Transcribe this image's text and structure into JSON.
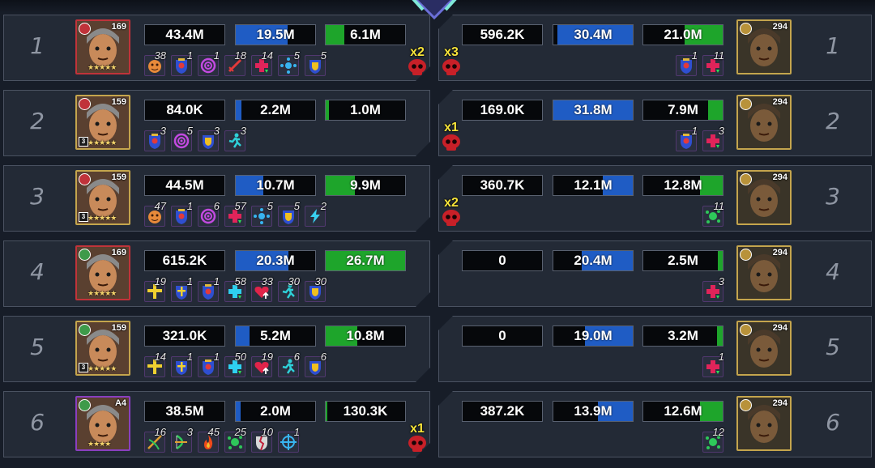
{
  "colors": {
    "damage": "#d8202a",
    "tank": "#1f5cc4",
    "heal": "#1ea52b",
    "gold_frame": "#c4a54d",
    "red_frame": "#c0333a",
    "purple_frame": "#8a3fc0",
    "kill_label": "#f6e43a"
  },
  "rows": [
    {
      "rank": "1",
      "left": {
        "hero": {
          "level": "169",
          "frame": "red",
          "faction": "red",
          "stars": "★★★★★",
          "awaken": ""
        },
        "stats": {
          "damage": {
            "label": "43.4M",
            "fill": 1.0
          },
          "tank": {
            "label": "19.5M",
            "fill": 0.65
          },
          "heal": {
            "label": "6.1M",
            "fill": 0.23
          }
        },
        "buffs": [
          {
            "icon": "orange-face-icon",
            "count": "38"
          },
          {
            "icon": "shield-crest-icon",
            "count": "1"
          },
          {
            "icon": "purple-swirl-icon",
            "count": "1"
          },
          {
            "icon": "red-sword-icon",
            "count": "18"
          },
          {
            "icon": "red-heal-cross-icon",
            "count": "14"
          },
          {
            "icon": "blue-burst-icon",
            "count": "5"
          },
          {
            "icon": "gold-shield-icon",
            "count": "5"
          }
        ],
        "kills": "x2"
      },
      "right": {
        "hero": {
          "level": "294",
          "frame": "gold",
          "faction": "gold"
        },
        "stats": {
          "damage": {
            "label": "596.2K",
            "fill": 0.02
          },
          "tank": {
            "label": "30.4M",
            "fill": 0.95
          },
          "heal": {
            "label": "21.0M",
            "fill": 0.48
          }
        },
        "buffs": [
          {
            "icon": "red-heal-cross-icon",
            "count": "11"
          },
          {
            "icon": "shield-crest-icon",
            "count": "1"
          }
        ],
        "kills": "x3"
      }
    },
    {
      "rank": "2",
      "left": {
        "hero": {
          "level": "159",
          "frame": "gold",
          "faction": "red",
          "stars": "★★★★★",
          "awaken": "3"
        },
        "stats": {
          "damage": {
            "label": "84.0K",
            "fill": 0.02
          },
          "tank": {
            "label": "2.2M",
            "fill": 0.07
          },
          "heal": {
            "label": "1.0M",
            "fill": 0.04
          }
        },
        "buffs": [
          {
            "icon": "shield-crest-icon",
            "count": "3"
          },
          {
            "icon": "purple-swirl-icon",
            "count": "5"
          },
          {
            "icon": "gold-shield-icon",
            "count": "3"
          },
          {
            "icon": "cyan-runner-icon",
            "count": "3"
          }
        ],
        "kills": ""
      },
      "right": {
        "hero": {
          "level": "294",
          "frame": "gold",
          "faction": "gold"
        },
        "stats": {
          "damage": {
            "label": "169.0K",
            "fill": 0.02
          },
          "tank": {
            "label": "31.8M",
            "fill": 1.0
          },
          "heal": {
            "label": "7.9M",
            "fill": 0.18
          }
        },
        "buffs": [
          {
            "icon": "red-heal-cross-icon",
            "count": "3"
          },
          {
            "icon": "shield-crest-icon",
            "count": "1"
          }
        ],
        "kills": "x1"
      }
    },
    {
      "rank": "3",
      "left": {
        "hero": {
          "level": "159",
          "frame": "gold",
          "faction": "red",
          "stars": "★★★★★",
          "awaken": "3"
        },
        "stats": {
          "damage": {
            "label": "44.5M",
            "fill": 1.0
          },
          "tank": {
            "label": "10.7M",
            "fill": 0.35
          },
          "heal": {
            "label": "9.9M",
            "fill": 0.37
          }
        },
        "buffs": [
          {
            "icon": "orange-face-icon",
            "count": "47"
          },
          {
            "icon": "shield-crest-icon",
            "count": "1"
          },
          {
            "icon": "purple-swirl-icon",
            "count": "6"
          },
          {
            "icon": "red-heal-cross-icon",
            "count": "57"
          },
          {
            "icon": "blue-burst-icon",
            "count": "5"
          },
          {
            "icon": "gold-shield-icon",
            "count": "5"
          },
          {
            "icon": "lightning-icon",
            "count": "2"
          }
        ],
        "kills": ""
      },
      "right": {
        "hero": {
          "level": "294",
          "frame": "gold",
          "faction": "gold"
        },
        "stats": {
          "damage": {
            "label": "360.7K",
            "fill": 0.02
          },
          "tank": {
            "label": "12.1M",
            "fill": 0.38
          },
          "heal": {
            "label": "12.8M",
            "fill": 0.29
          }
        },
        "buffs": [
          {
            "icon": "green-splat-icon",
            "count": "11"
          }
        ],
        "kills": "x2"
      }
    },
    {
      "rank": "4",
      "left": {
        "hero": {
          "level": "169",
          "frame": "red",
          "faction": "green",
          "stars": "★★★★★",
          "awaken": ""
        },
        "stats": {
          "damage": {
            "label": "615.2K",
            "fill": 0.02
          },
          "tank": {
            "label": "20.3M",
            "fill": 0.66
          },
          "heal": {
            "label": "26.7M",
            "fill": 1.0
          }
        },
        "buffs": [
          {
            "icon": "gold-cross-icon",
            "count": "19"
          },
          {
            "icon": "blue-cross-shield-icon",
            "count": "1"
          },
          {
            "icon": "shield-crest-icon",
            "count": "1"
          },
          {
            "icon": "cyan-heal-cross-icon",
            "count": "58"
          },
          {
            "icon": "heart-up-icon",
            "count": "33"
          },
          {
            "icon": "cyan-runner-icon",
            "count": "30"
          },
          {
            "icon": "gold-shield-icon",
            "count": "30"
          }
        ],
        "kills": ""
      },
      "right": {
        "hero": {
          "level": "294",
          "frame": "gold",
          "faction": "gold"
        },
        "stats": {
          "damage": {
            "label": "0",
            "fill": 0.02
          },
          "tank": {
            "label": "20.4M",
            "fill": 0.64
          },
          "heal": {
            "label": "2.5M",
            "fill": 0.06
          }
        },
        "buffs": [
          {
            "icon": "red-heal-cross-icon",
            "count": "3"
          }
        ],
        "kills": ""
      }
    },
    {
      "rank": "5",
      "left": {
        "hero": {
          "level": "159",
          "frame": "gold",
          "faction": "green",
          "stars": "★★★★★",
          "awaken": "3"
        },
        "stats": {
          "damage": {
            "label": "321.0K",
            "fill": 0.02
          },
          "tank": {
            "label": "5.2M",
            "fill": 0.17
          },
          "heal": {
            "label": "10.8M",
            "fill": 0.4
          }
        },
        "buffs": [
          {
            "icon": "gold-cross-icon",
            "count": "14"
          },
          {
            "icon": "blue-cross-shield-icon",
            "count": "1"
          },
          {
            "icon": "shield-crest-icon",
            "count": "1"
          },
          {
            "icon": "cyan-heal-cross-icon",
            "count": "50"
          },
          {
            "icon": "heart-up-icon",
            "count": "19"
          },
          {
            "icon": "cyan-runner-icon",
            "count": "6"
          },
          {
            "icon": "gold-shield-icon",
            "count": "6"
          }
        ],
        "kills": ""
      },
      "right": {
        "hero": {
          "level": "294",
          "frame": "gold",
          "faction": "gold"
        },
        "stats": {
          "damage": {
            "label": "0",
            "fill": 0.02
          },
          "tank": {
            "label": "19.0M",
            "fill": 0.6
          },
          "heal": {
            "label": "3.2M",
            "fill": 0.07
          }
        },
        "buffs": [
          {
            "icon": "red-heal-cross-icon",
            "count": "1"
          }
        ],
        "kills": ""
      }
    },
    {
      "rank": "6",
      "left": {
        "hero": {
          "level": "A4",
          "frame": "purple",
          "faction": "green",
          "stars": "★★★★",
          "awaken": ""
        },
        "stats": {
          "damage": {
            "label": "38.5M",
            "fill": 0.86
          },
          "tank": {
            "label": "2.0M",
            "fill": 0.06
          },
          "heal": {
            "label": "130.3K",
            "fill": 0.02
          }
        },
        "buffs": [
          {
            "icon": "crossbow-icon",
            "count": "16"
          },
          {
            "icon": "green-bow-icon",
            "count": "3"
          },
          {
            "icon": "fire-icon",
            "count": "45"
          },
          {
            "icon": "green-splat-icon",
            "count": "25"
          },
          {
            "icon": "broken-shield-icon",
            "count": "10"
          },
          {
            "icon": "crosshair-icon",
            "count": "1"
          }
        ],
        "kills": "x1"
      },
      "right": {
        "hero": {
          "level": "294",
          "frame": "gold",
          "faction": "gold"
        },
        "stats": {
          "damage": {
            "label": "387.2K",
            "fill": 0.02
          },
          "tank": {
            "label": "13.9M",
            "fill": 0.44
          },
          "heal": {
            "label": "12.6M",
            "fill": 0.29
          }
        },
        "buffs": [
          {
            "icon": "green-splat-icon",
            "count": "12"
          }
        ],
        "kills": ""
      }
    }
  ]
}
